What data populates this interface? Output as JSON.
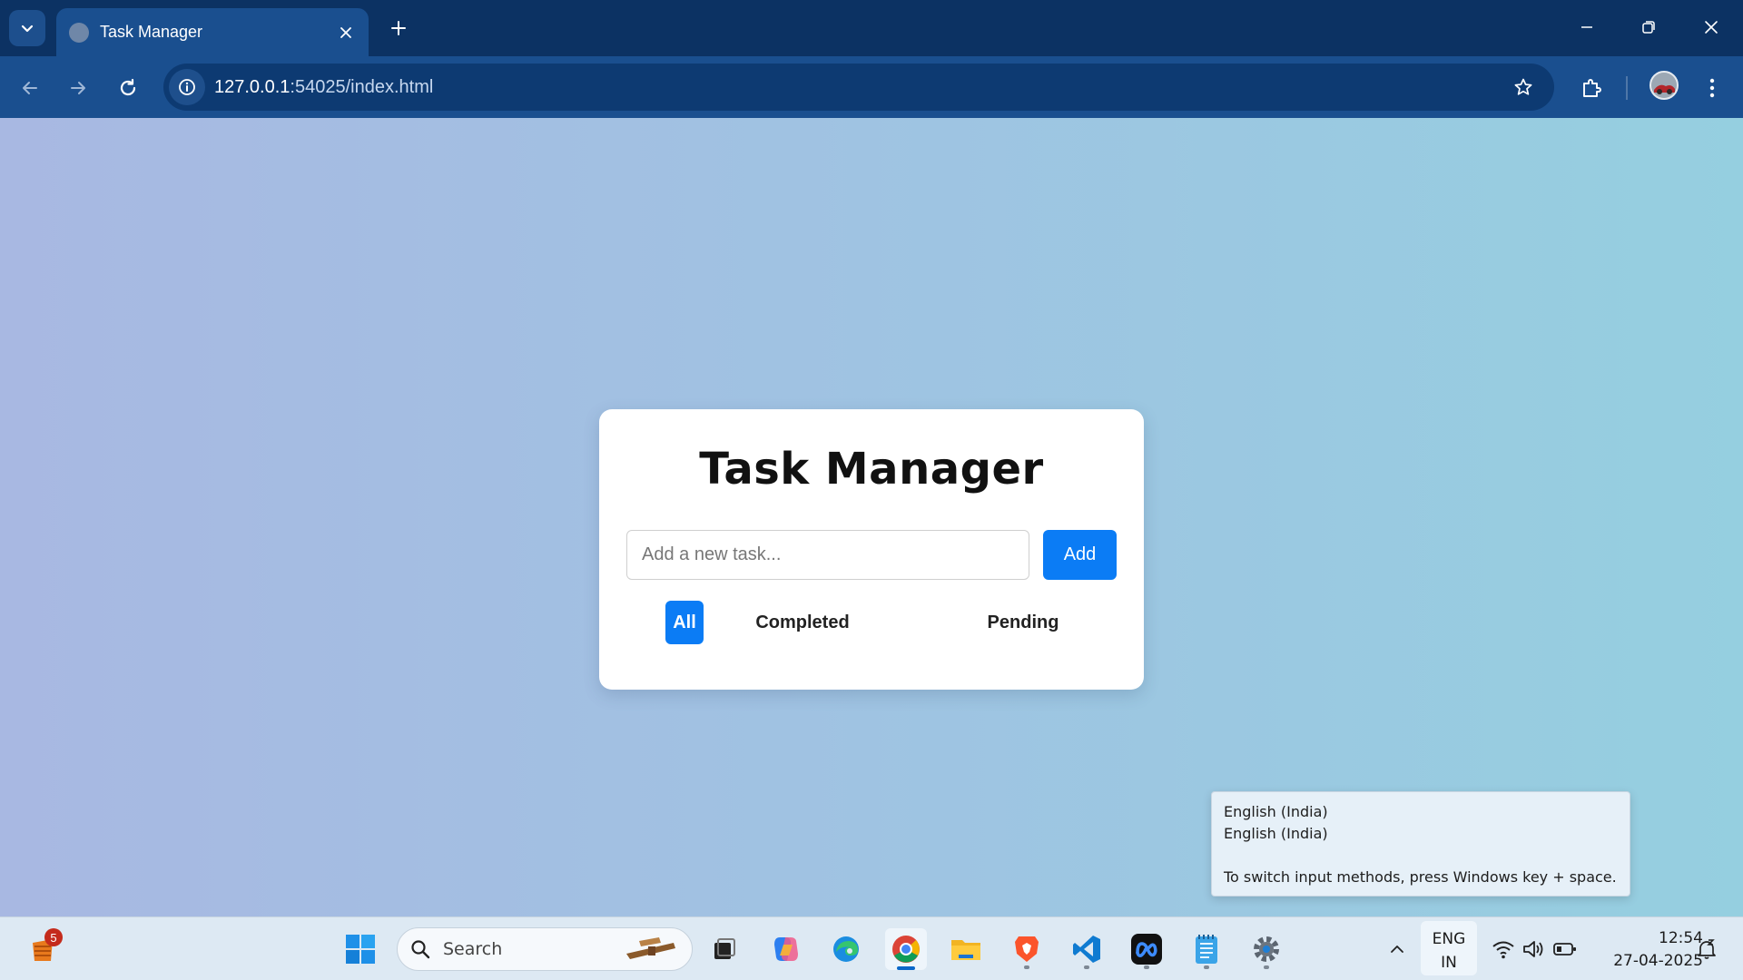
{
  "browser": {
    "tab_title": "Task Manager",
    "url_host": "127.0.0.1",
    "url_rest": ":54025/index.html"
  },
  "app": {
    "title": "Task Manager",
    "input_placeholder": "Add a new task...",
    "add_label": "Add",
    "filters": [
      {
        "label": "All",
        "active": true
      },
      {
        "label": "Completed",
        "active": false
      },
      {
        "label": "Pending",
        "active": false
      }
    ],
    "accent_color": "#0b7cf5"
  },
  "language_tooltip": {
    "line1": "English (India)",
    "line2": "English (India)",
    "hint": "To switch input methods, press Windows key + space."
  },
  "taskbar": {
    "widgets_badge": "5",
    "search_label": "Search",
    "ime_line1": "ENG",
    "ime_line2": "IN",
    "time": "12:54",
    "date": "27-04-2025",
    "apps": [
      "start-icon",
      "task-view-icon",
      "copilot-icon",
      "edge-icon",
      "chrome-icon",
      "file-explorer-icon",
      "brave-icon",
      "vscode-icon",
      "meta-app-icon",
      "notepad-icon",
      "settings-icon"
    ]
  }
}
